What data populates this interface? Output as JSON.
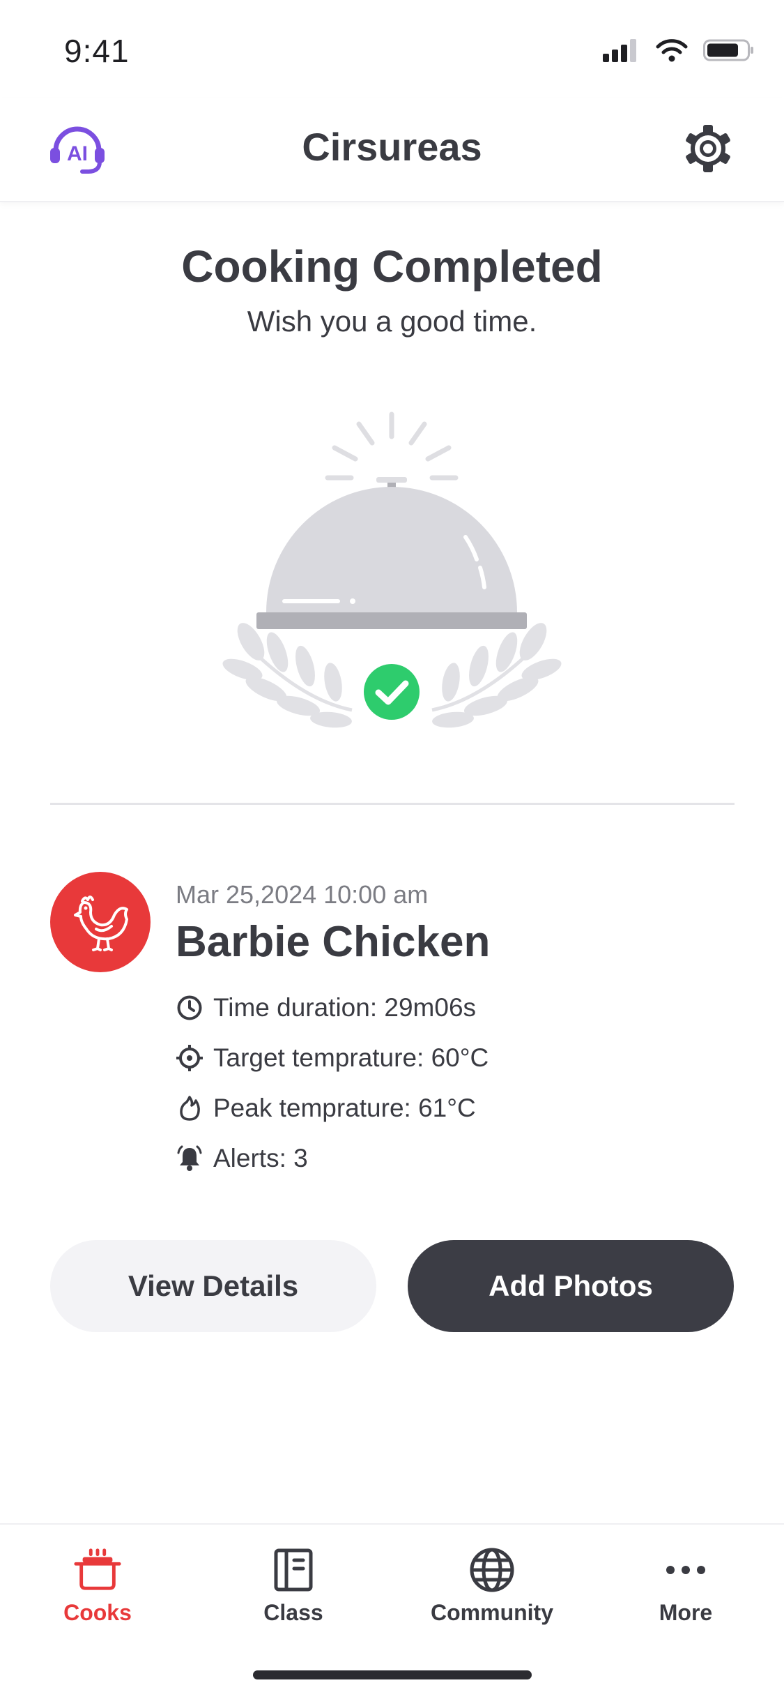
{
  "status_bar": {
    "time": "9:41"
  },
  "header": {
    "title": "Cirsureas",
    "ai_icon": "ai-headset-icon",
    "settings_icon": "gear-icon"
  },
  "completion": {
    "title": "Cooking Completed",
    "subtitle": "Wish you a good time.",
    "illustration": "cloche-with-laurel-and-check"
  },
  "cook": {
    "date": "Mar 25,2024 10:00 am",
    "name": "Barbie Chicken",
    "avatar_icon": "chicken-icon",
    "details": [
      {
        "icon": "clock-icon",
        "text": "Time duration: 29m06s"
      },
      {
        "icon": "target-icon",
        "text": "Target temprature: 60°C"
      },
      {
        "icon": "flame-icon",
        "text": "Peak temprature: 61°C"
      },
      {
        "icon": "bell-icon",
        "text": "Alerts: 3"
      }
    ]
  },
  "actions": {
    "view_details": "View Details",
    "add_photos": "Add Photos"
  },
  "tabs": [
    {
      "label": "Cooks",
      "icon": "pot-icon",
      "active": true
    },
    {
      "label": "Class",
      "icon": "book-icon",
      "active": false
    },
    {
      "label": "Community",
      "icon": "globe-icon",
      "active": false
    },
    {
      "label": "More",
      "icon": "more-dots-icon",
      "active": false
    }
  ],
  "colors": {
    "accent": "#e8393a",
    "success": "#2ecc6d",
    "dark_button": "#3c3d45",
    "ai_purple": "#7b4fe0"
  }
}
